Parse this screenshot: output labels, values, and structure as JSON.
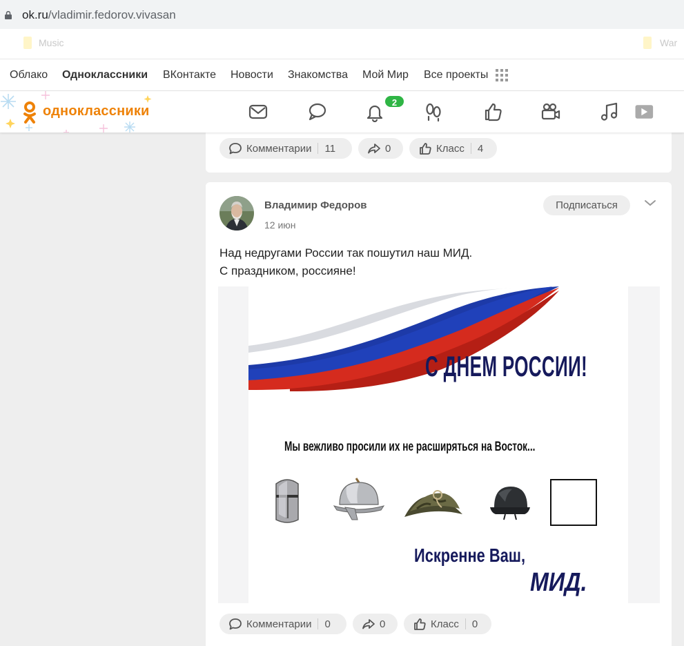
{
  "browser": {
    "url_host": "ok.ru",
    "url_path": "/vladimir.fedorov.vivasan",
    "bookmarks": [
      "Music",
      "War"
    ]
  },
  "projects_bar": {
    "items": [
      "Облако",
      "Одноклассники",
      "ВКонтакте",
      "Новости",
      "Знакомства",
      "Мой Мир",
      "Все проекты"
    ]
  },
  "toolbar": {
    "logo": "одноклассники",
    "notifications_count": "2"
  },
  "post_prev": {
    "comments_label": "Комментарии",
    "comments_count": "11",
    "shares_count": "0",
    "likes_label": "Класс",
    "likes_count": "4"
  },
  "post": {
    "author": "Владимир Федоров",
    "date": "12 июн",
    "subscribe_label": "Подписаться",
    "text_line1": "Над недругами России так пошутил  наш МИД.",
    "text_line2": "С праздником, россияне!",
    "image": {
      "headline": "С ДНЕМ РОССИИ!",
      "subline": "Мы вежливо просили их не расширяться на Восток...",
      "closing": "Искренне Ваш,",
      "signature": "МИД."
    },
    "comments_label": "Комментарии",
    "comments_count": "0",
    "shares_count": "0",
    "likes_label": "Класс",
    "likes_count": "0"
  },
  "colors": {
    "ok_orange": "#ee8208",
    "badge_green": "#2fb545",
    "flag_blue": "#1d3aa8",
    "flag_red": "#d52b1e",
    "text_navy": "#161a5c"
  }
}
